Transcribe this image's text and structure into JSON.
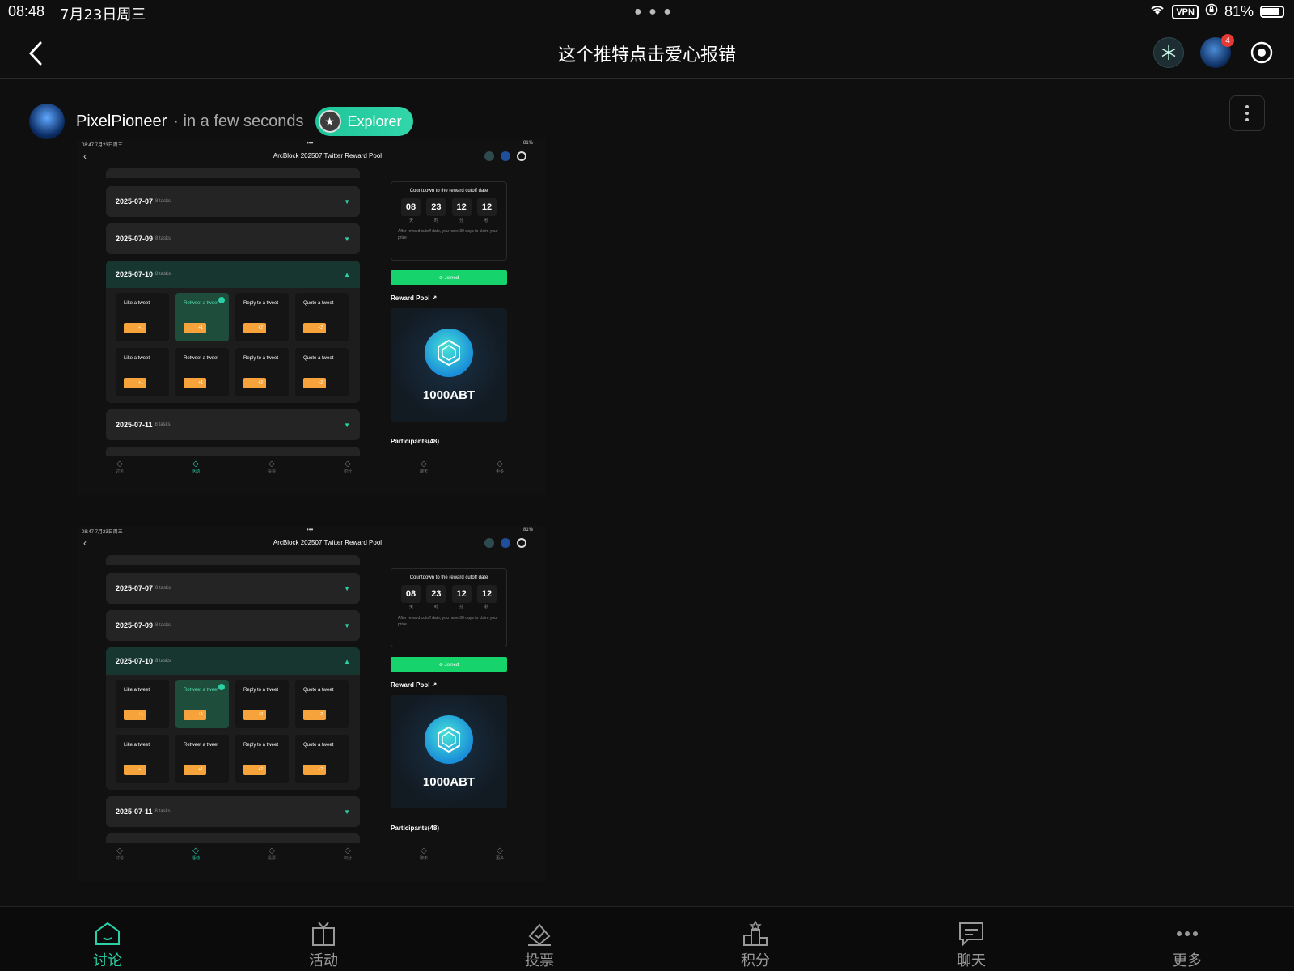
{
  "status": {
    "time": "08:48",
    "date": "7月23日周三",
    "vpn": "VPN",
    "battery": "81%",
    "battery_level": 0.81
  },
  "nav": {
    "title": "这个推特点击爱心报错",
    "notif_count": "4"
  },
  "post": {
    "author": "PixelPioneer",
    "time": "· in a few seconds",
    "badge": "Explorer"
  },
  "shot": {
    "time": "08:47",
    "date": "7月23日周三",
    "status_right": "81%",
    "title": "ArcBlock 202507 Twitter Reward Pool",
    "dates": [
      {
        "date": "2025-07-07",
        "tasks": "8 tasks"
      },
      {
        "date": "2025-07-09",
        "tasks": "8 tasks"
      },
      {
        "date": "2025-07-10",
        "tasks": "8 tasks"
      },
      {
        "date": "2025-07-11",
        "tasks": "8 tasks"
      }
    ],
    "task_grid": [
      {
        "label": "Like a tweet",
        "points": "+1",
        "done": false
      },
      {
        "label": "Retweet a tweet",
        "points": "+1",
        "done": true
      },
      {
        "label": "Reply to a tweet",
        "points": "+2",
        "done": false
      },
      {
        "label": "Quote a tweet",
        "points": "+2",
        "done": false
      },
      {
        "label": "Like a tweet",
        "points": "+1",
        "done": false
      },
      {
        "label": "Retweet a tweet",
        "points": "+1",
        "done": false
      },
      {
        "label": "Reply to a tweet",
        "points": "+2",
        "done": false
      },
      {
        "label": "Quote a tweet",
        "points": "+2",
        "done": false
      }
    ],
    "countdown": {
      "title": "Countdown to the reward cutoff date",
      "nums": [
        "08",
        "23",
        "12",
        "12"
      ],
      "units": [
        "天",
        "时",
        "分",
        "秒"
      ],
      "note": "After reward cutoff date, you have 30 days to claim your prize"
    },
    "joined": "Joined",
    "reward_pool_label": "Reward Pool",
    "reward_amount": "1000ABT",
    "participants": "Participants(48)",
    "tabs": [
      "讨论",
      "活动",
      "投票",
      "积分",
      "聊天",
      "更多"
    ]
  },
  "tabbar": {
    "items": [
      {
        "label": "讨论",
        "icon": "home-icon",
        "active": true
      },
      {
        "label": "活动",
        "icon": "gift-icon",
        "active": false
      },
      {
        "label": "投票",
        "icon": "vote-icon",
        "active": false
      },
      {
        "label": "积分",
        "icon": "leaderboard-icon",
        "active": false
      },
      {
        "label": "聊天",
        "icon": "chat-icon",
        "active": false
      },
      {
        "label": "更多",
        "icon": "more-icon",
        "active": false
      }
    ]
  },
  "colors": {
    "accent": "#2ad1a7",
    "joined": "#16d36b",
    "badge": "#1fc59a",
    "notif": "#e53935"
  }
}
